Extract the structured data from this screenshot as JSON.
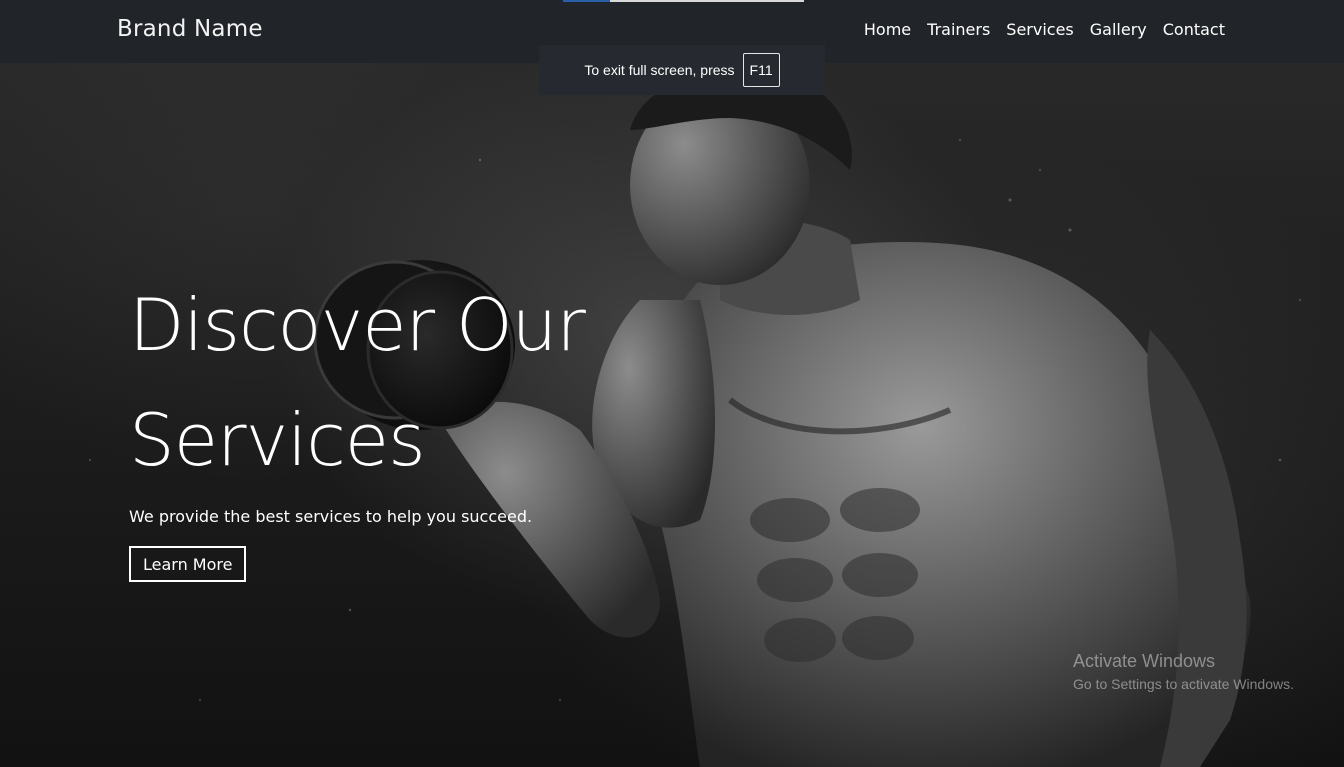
{
  "navbar": {
    "brand": "Brand Name",
    "links": [
      "Home",
      "Trainers",
      "Services",
      "Gallery",
      "Contact"
    ],
    "background": "#212529"
  },
  "fullscreen_notice": {
    "text": "To exit full screen, press",
    "key": "F11"
  },
  "hero": {
    "title_line1": "Discover Our",
    "title_line2": "Services",
    "subtitle": "We provide the best services to help you succeed.",
    "button_label": "Learn More",
    "image": "bodybuilder-with-dumbbell-photo"
  },
  "watermark": {
    "title": "Activate Windows",
    "subtitle": "Go to Settings to activate Windows."
  }
}
